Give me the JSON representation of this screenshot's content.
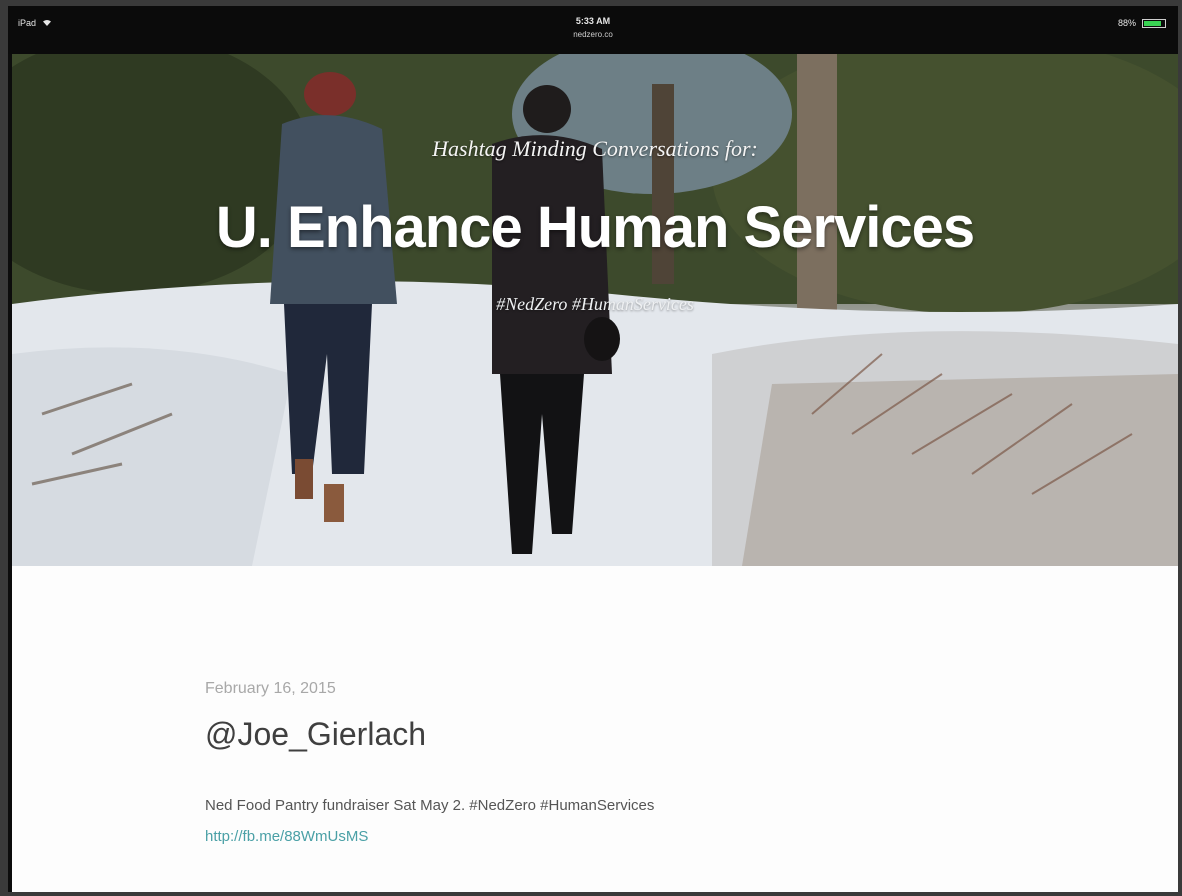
{
  "statusbar": {
    "device": "iPad",
    "time": "5:33 AM",
    "url": "nedzero.co",
    "battery": "88%",
    "battery_level": 0.88
  },
  "hero": {
    "subtitle": "Hashtag Minding Conversations for:",
    "title": "U. Enhance Human Services",
    "tags": "#NedZero #HumanServices"
  },
  "post": {
    "date": "February 16, 2015",
    "author": "@Joe_Gierlach",
    "text": "Ned Food Pantry fundraiser Sat May 2. #NedZero #HumanServices",
    "link": "http://fb.me/88WmUsMS"
  }
}
